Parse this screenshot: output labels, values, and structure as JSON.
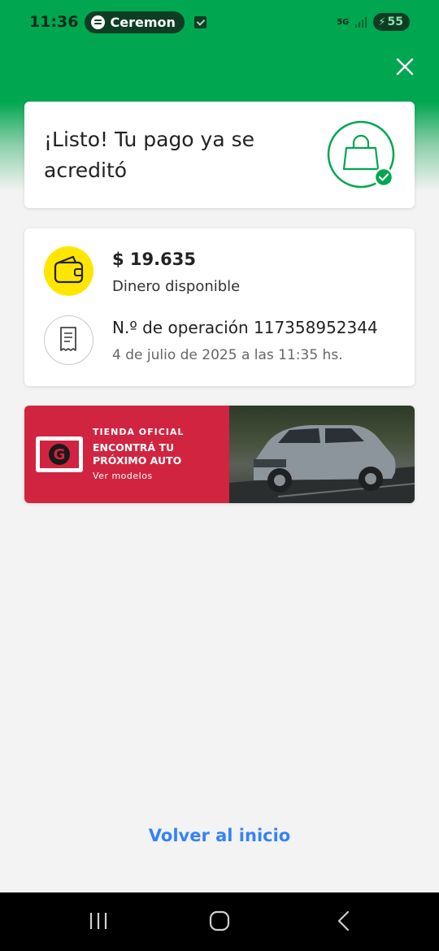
{
  "status_bar": {
    "time": "11:36",
    "media_app": "Ceremon",
    "network": "5G",
    "battery": "55"
  },
  "status_card": {
    "title": "¡Listo! Tu pago ya se acreditó",
    "icon": "shopping-bag-check-icon",
    "accent_color": "#00a650"
  },
  "details": {
    "balance_amount": "$ 19.635",
    "balance_label": "Dinero disponible",
    "operation_label": "N.º de operación 117358952344",
    "operation_date": "4 de julio de 2025 a las 11:35 hs."
  },
  "banner": {
    "kicker": "TIENDA OFICIAL",
    "title": "ENCONTRÁ TU PRÓXIMO AUTO",
    "cta": "Ver modelos",
    "logo_letter": "G",
    "background_color": "#d12440"
  },
  "footer": {
    "back_home_label": "Volver al inicio",
    "link_color": "#3483fa"
  }
}
